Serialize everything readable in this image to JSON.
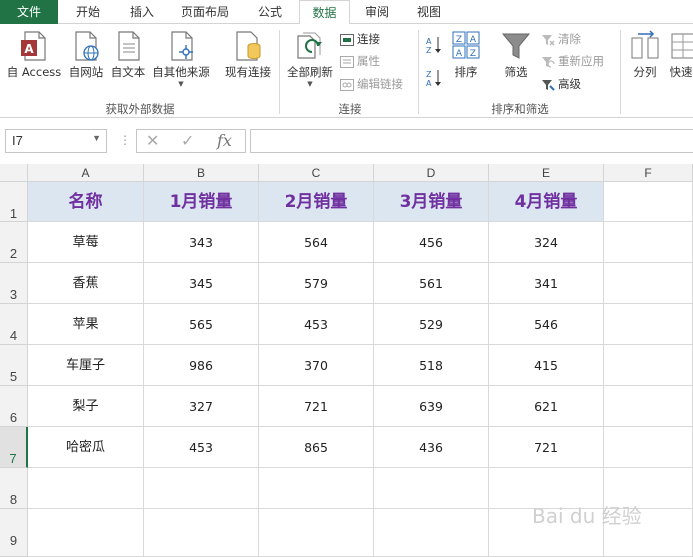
{
  "tabs": [
    "文件",
    "开始",
    "插入",
    "页面布局",
    "公式",
    "数据",
    "审阅",
    "视图"
  ],
  "ribbon": {
    "get_external": {
      "buttons": [
        "自 Access",
        "自网站",
        "自文本",
        "自其他来源",
        "现有连接"
      ],
      "label": "获取外部数据"
    },
    "connections": {
      "refresh_all": "全部刷新",
      "connections": "连接",
      "properties": "属性",
      "edit_links": "编辑链接",
      "label": "连接"
    },
    "sort_filter": {
      "sort": "排序",
      "filter": "筛选",
      "clear": "清除",
      "reapply": "重新应用",
      "advanced": "高级",
      "label": "排序和筛选"
    },
    "data_tools": {
      "split": "分列",
      "quick": "快速"
    }
  },
  "formula_bar": {
    "name_box": "I7",
    "fx": "fx",
    "formula": ""
  },
  "columns": [
    "A",
    "B",
    "C",
    "D",
    "E",
    "F"
  ],
  "rows": [
    "1",
    "2",
    "3",
    "4",
    "5",
    "6",
    "7",
    "8",
    "9"
  ],
  "selected_row": "7",
  "table": {
    "headers": [
      "名称",
      "1月销量",
      "2月销量",
      "3月销量",
      "4月销量"
    ],
    "data": [
      [
        "草莓",
        "343",
        "564",
        "456",
        "324"
      ],
      [
        "香蕉",
        "345",
        "579",
        "561",
        "341"
      ],
      [
        "苹果",
        "565",
        "453",
        "529",
        "546"
      ],
      [
        "车厘子",
        "986",
        "370",
        "518",
        "415"
      ],
      [
        "梨子",
        "327",
        "721",
        "639",
        "621"
      ],
      [
        "哈密瓜",
        "453",
        "865",
        "436",
        "721"
      ]
    ]
  },
  "colors": {
    "accent": "#217346",
    "header_fill": "#dce6f1",
    "header_text": "#7030a0"
  },
  "watermark": "Bai du 经验"
}
